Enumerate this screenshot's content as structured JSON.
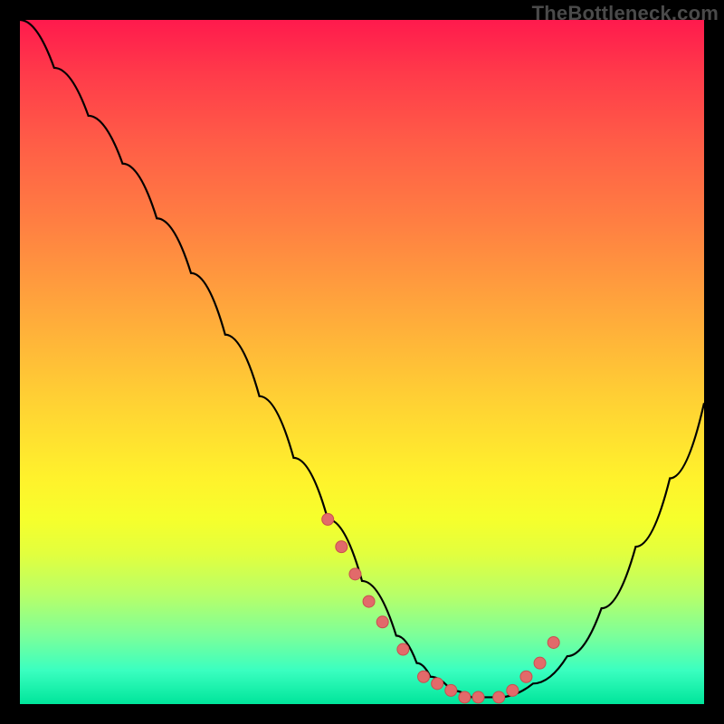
{
  "watermark": "TheBottleneck.com",
  "colors": {
    "frame": "#000000",
    "curve": "#000000",
    "dot_fill": "#e26a6a",
    "dot_stroke": "#c94f4f"
  },
  "chart_data": {
    "type": "line",
    "title": "",
    "xlabel": "",
    "ylabel": "",
    "xlim": [
      0,
      100
    ],
    "ylim": [
      0,
      100
    ],
    "curve": {
      "name": "bottleneck-curve",
      "x": [
        0,
        5,
        10,
        15,
        20,
        25,
        30,
        35,
        40,
        45,
        50,
        55,
        58,
        60,
        63,
        66,
        70,
        75,
        80,
        85,
        90,
        95,
        100
      ],
      "y_pct": [
        100,
        93,
        86,
        79,
        71,
        63,
        54,
        45,
        36,
        27,
        18,
        10,
        6,
        4,
        2,
        1,
        1,
        3,
        7,
        14,
        23,
        33,
        44
      ]
    },
    "dots": {
      "name": "marked-points",
      "x": [
        45,
        47,
        49,
        51,
        53,
        56,
        59,
        61,
        63,
        65,
        67,
        70,
        72,
        74,
        76,
        78
      ],
      "y_pct": [
        27,
        23,
        19,
        15,
        12,
        8,
        4,
        3,
        2,
        1,
        1,
        1,
        2,
        4,
        6,
        9
      ]
    }
  }
}
